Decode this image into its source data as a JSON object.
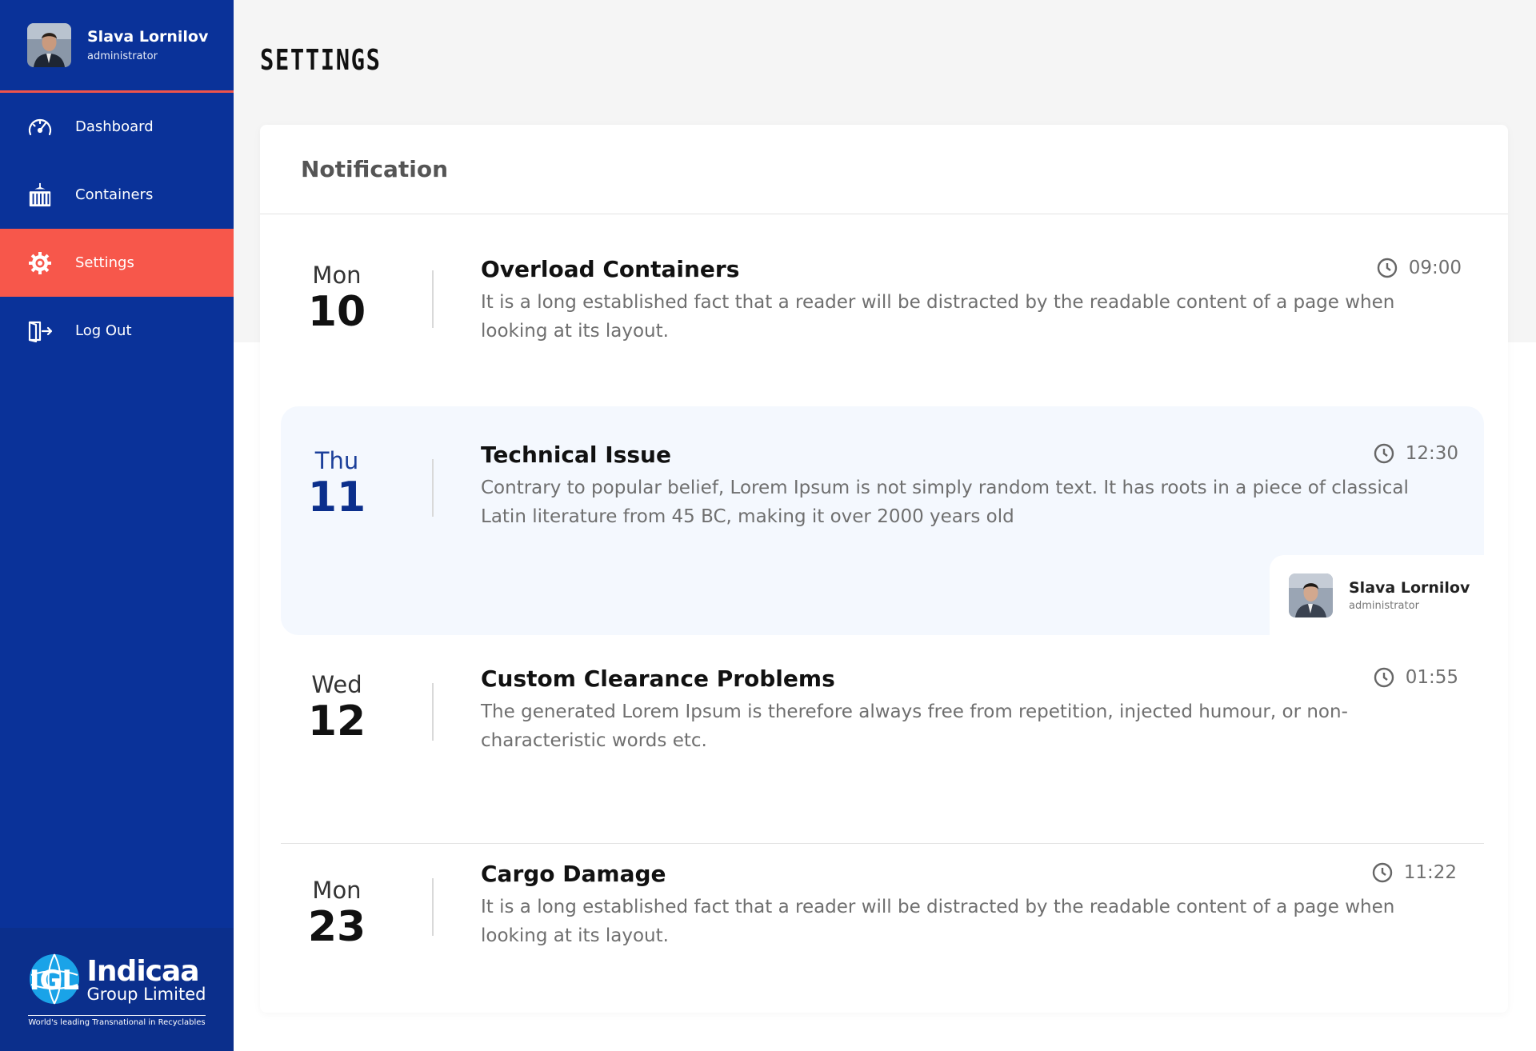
{
  "user": {
    "name": "Slava Lornilov",
    "role": "administrator"
  },
  "nav": [
    {
      "label": "Dashboard",
      "icon": "speedometer-icon",
      "active": false
    },
    {
      "label": "Containers",
      "icon": "container-icon",
      "active": false
    },
    {
      "label": "Settings",
      "icon": "gear-icon",
      "active": true
    },
    {
      "label": "Log Out",
      "icon": "logout-icon",
      "active": false
    }
  ],
  "brand": {
    "name": "Indicaa",
    "sub": "Group Limited",
    "tagline": "World's leading Transnational in Recyclables",
    "logo_letters": "IGL"
  },
  "page": {
    "title": "SETTINGS"
  },
  "card": {
    "title": "Notification"
  },
  "notifications": [
    {
      "day": "Mon",
      "date": "10",
      "title": "Overload Containers",
      "time": "09:00",
      "body": "It is a long established fact that a reader will be distracted by the readable content of a page when looking at its layout."
    },
    {
      "day": "Thu",
      "date": "11",
      "title": "Technical Issue",
      "time": "12:30",
      "body": "Contrary to popular belief, Lorem Ipsum is not simply random text. It has roots in a piece of classical Latin literature from 45 BC, making it over 2000 years old",
      "author": {
        "name": "Slava Lornilov",
        "role": "administrator"
      }
    },
    {
      "day": "Wed",
      "date": "12",
      "title": "Custom Clearance Problems",
      "time": "01:55",
      "body": "The generated Lorem Ipsum is therefore always free from repetition, injected humour, or non-characteristic words etc."
    },
    {
      "day": "Mon",
      "date": "23",
      "title": "Cargo Damage",
      "time": "11:22",
      "body": "It is a long established fact that a reader will be distracted by the readable content of a page when looking at its layout."
    }
  ],
  "colors": {
    "sidebar": "#0a3299",
    "accent": "#f7574b",
    "highlight": "#f4f8fe"
  }
}
